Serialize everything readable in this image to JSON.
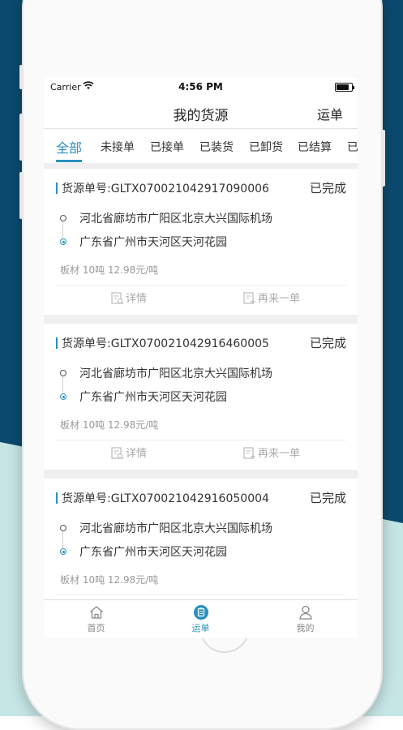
{
  "status_bar": {
    "carrier": "Carrier",
    "time": "4:56 PM"
  },
  "nav": {
    "title": "我的货源",
    "right": "运单"
  },
  "tabs": [
    "全部",
    "未接单",
    "已接单",
    "已装货",
    "已卸货",
    "已结算",
    "已"
  ],
  "cards": [
    {
      "order_label": "货源单号:GLTX070021042917090006",
      "status": "已完成",
      "from": "河北省廊坊市广阳区北京大兴国际机场",
      "to": "广东省广州市天河区天河花园",
      "meta": "板材 10吨 12.98元/吨",
      "detail": "详情",
      "reorder": "再来一单"
    },
    {
      "order_label": "货源单号:GLTX070021042916460005",
      "status": "已完成",
      "from": "河北省廊坊市广阳区北京大兴国际机场",
      "to": "广东省广州市天河区天河花园",
      "meta": "板材 10吨 12.98元/吨",
      "detail": "详情",
      "reorder": "再来一单"
    },
    {
      "order_label": "货源单号:GLTX070021042916050004",
      "status": "已完成",
      "from": "河北省廊坊市广阳区北京大兴国际机场",
      "to": "广东省广州市天河区天河花园",
      "meta": "板材 10吨 12.98元/吨"
    }
  ],
  "tabbar": [
    {
      "label": "首页",
      "icon": "home-icon"
    },
    {
      "label": "运单",
      "icon": "clipboard-icon"
    },
    {
      "label": "我的",
      "icon": "user-icon"
    }
  ],
  "colors": {
    "accent": "#2a8fbe",
    "bg_dark": "#0b4a6e",
    "bg_light": "#c6e6e5"
  }
}
